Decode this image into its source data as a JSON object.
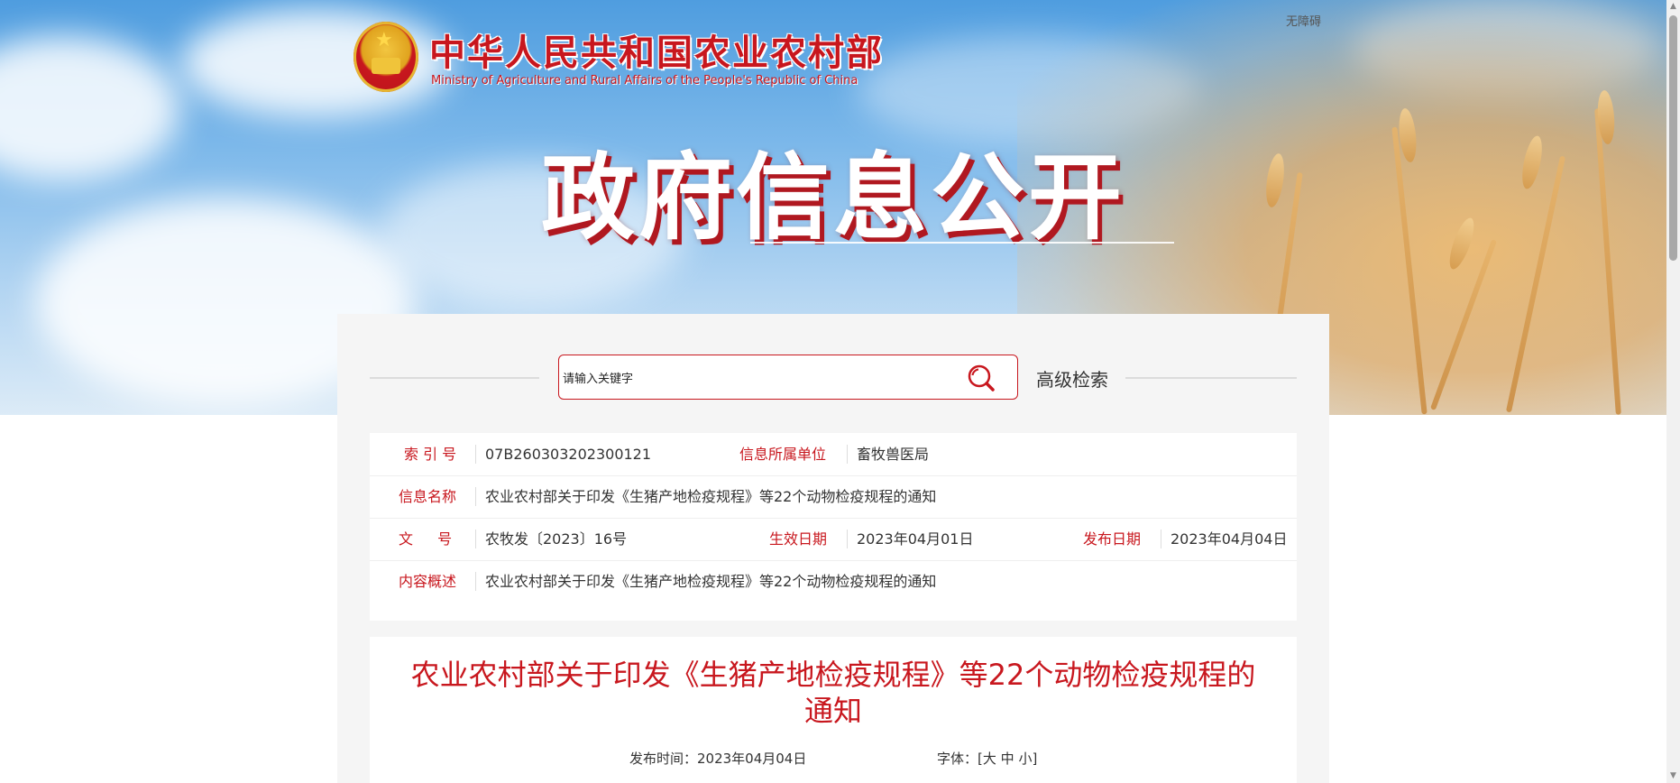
{
  "header": {
    "ministry_name_cn": "中华人民共和国农业农村部",
    "ministry_name_en": "Ministry of Agriculture and Rural Affairs of the People's Republic of China",
    "accessibility_link": "无障碍",
    "hero_title": "政府信息公开"
  },
  "search": {
    "placeholder": "请输入关键字",
    "advanced_label": "高级检索",
    "icon": "search-icon"
  },
  "info": {
    "index_label": "索 引 号",
    "index_value": "07B260303202300121",
    "unit_label": "信息所属单位",
    "unit_value": "畜牧兽医局",
    "name_label": "信息名称",
    "name_value": "农业农村部关于印发《生猪产地检疫规程》等22个动物检疫规程的通知",
    "doc_label": "文 号",
    "doc_value": "农牧发〔2023〕16号",
    "effective_label": "生效日期",
    "effective_value": "2023年04月01日",
    "publish_label": "发布日期",
    "publish_value": "2023年04月04日",
    "summary_label": "内容概述",
    "summary_value": "农业农村部关于印发《生猪产地检疫规程》等22个动物检疫规程的通知"
  },
  "article": {
    "title": "农业农村部关于印发《生猪产地检疫规程》等22个动物检疫规程的通知",
    "publish_time": "发布时间：2023年04月04日",
    "font_label": "字体：[",
    "font_large": "大",
    "font_medium": "中",
    "font_small": "小",
    "font_close": "]"
  },
  "colors": {
    "accent": "#c8171e",
    "panel_bg": "#f5f5f5"
  }
}
